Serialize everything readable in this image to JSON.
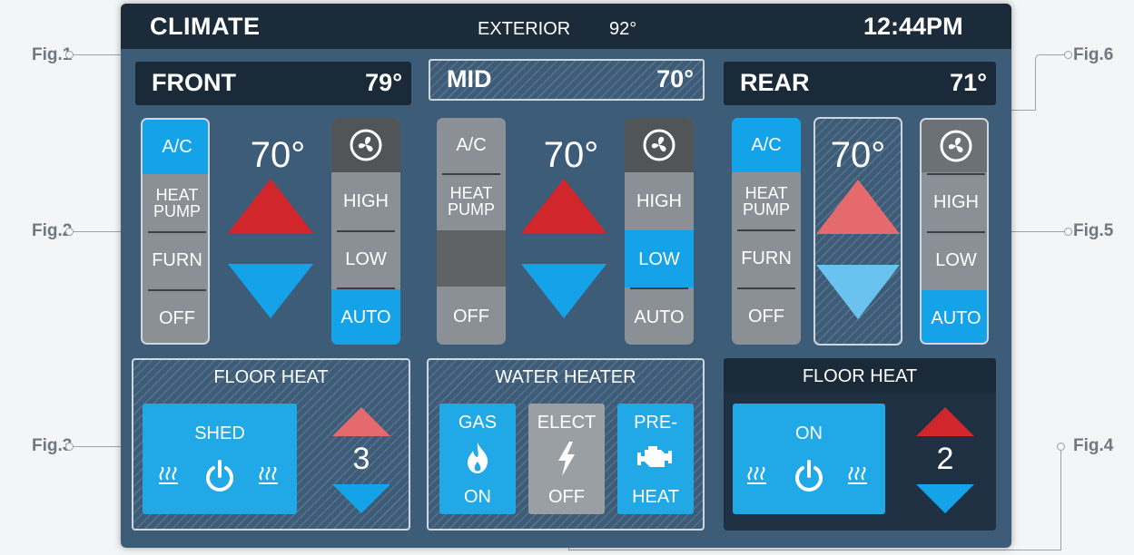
{
  "callouts": [
    "Fig.1",
    "Fig.2",
    "Fig.3",
    "Fig.6",
    "Fig.5",
    "Fig.4"
  ],
  "topbar": {
    "title": "CLIMATE",
    "exterior_label": "EXTERIOR",
    "exterior_temp": "92°",
    "time": "12:44PM"
  },
  "zones": {
    "front": {
      "name": "FRONT",
      "temp": "79°",
      "setpoint": "70°",
      "modes": [
        "A/C",
        "HEAT\nPUMP",
        "FURN",
        "OFF"
      ],
      "active_mode": "A/C",
      "fan": [
        "HIGH",
        "LOW",
        "AUTO"
      ],
      "active_fan": "AUTO"
    },
    "mid": {
      "name": "MID",
      "temp": "70°",
      "setpoint": "70°",
      "modes": [
        "A/C",
        "HEAT\nPUMP",
        "OFF"
      ],
      "active_mode": "",
      "fan": [
        "HIGH",
        "LOW",
        "AUTO"
      ],
      "active_fan": "LOW"
    },
    "rear": {
      "name": "REAR",
      "temp": "71°",
      "setpoint": "70°",
      "modes": [
        "A/C",
        "HEAT\nPUMP",
        "FURN",
        "OFF"
      ],
      "active_mode": "A/C",
      "fan": [
        "HIGH",
        "LOW",
        "AUTO"
      ],
      "active_fan": "AUTO"
    }
  },
  "front_floor_heat": {
    "title": "FLOOR HEAT",
    "button_label": "SHED",
    "level": "3"
  },
  "water_heater": {
    "title": "WATER HEATER",
    "gas": {
      "top": "GAS",
      "bottom": "ON"
    },
    "elect": {
      "top": "ELECT",
      "bottom": "OFF"
    },
    "preheat": {
      "top": "PRE-",
      "bottom": "HEAT"
    }
  },
  "rear_floor_heat": {
    "title": "FLOOR HEAT",
    "button_label": "ON",
    "level": "2"
  },
  "icons": [
    "fan-icon",
    "power-icon",
    "heat-wave-icon",
    "flame-icon",
    "bolt-icon",
    "engine-icon"
  ],
  "colors": {
    "accent_blue": "#14a3e8",
    "up_red": "#d0262c",
    "panel_navy": "#1b2a39",
    "screen_blue": "#3d5c78"
  }
}
